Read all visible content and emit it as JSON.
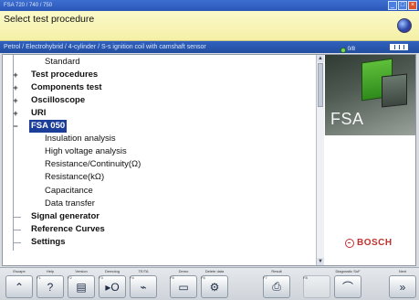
{
  "window": {
    "title": "FSA 720 / 740 / 750",
    "btn_min": "_",
    "btn_max": "□",
    "btn_close": "×"
  },
  "header": {
    "title": "Select test procedure",
    "globe_icon": "globe-icon"
  },
  "pathbar": {
    "text": "Petrol / Electrohybrid / 4-cylinder / S-s ignition coil with camshaft sensor",
    "indicator": "0/8"
  },
  "tree": {
    "items": [
      {
        "label": "Standard",
        "level": 1,
        "bold": false,
        "expander": ""
      },
      {
        "label": "Test procedures",
        "level": 0,
        "bold": true,
        "expander": "+"
      },
      {
        "label": "Components test",
        "level": 0,
        "bold": true,
        "expander": "+"
      },
      {
        "label": "Oscilloscope",
        "level": 0,
        "bold": true,
        "expander": "+"
      },
      {
        "label": "URI",
        "level": 0,
        "bold": true,
        "expander": "+"
      },
      {
        "label": "FSA 050",
        "level": 0,
        "bold": true,
        "expander": "−",
        "selected": true
      },
      {
        "label": "Insulation analysis",
        "level": 1,
        "bold": false,
        "expander": ""
      },
      {
        "label": "High voltage analysis",
        "level": 1,
        "bold": false,
        "expander": ""
      },
      {
        "label": "Resistance/Continuity(Ω)",
        "level": 1,
        "bold": false,
        "expander": ""
      },
      {
        "label": "Resistance(kΩ)",
        "level": 1,
        "bold": false,
        "expander": ""
      },
      {
        "label": "Capacitance",
        "level": 1,
        "bold": false,
        "expander": ""
      },
      {
        "label": "Data transfer",
        "level": 1,
        "bold": false,
        "expander": ""
      },
      {
        "label": "Signal generator",
        "level": 0,
        "bold": true,
        "expander": ""
      },
      {
        "label": "Reference Curves",
        "level": 0,
        "bold": true,
        "expander": ""
      },
      {
        "label": "Settings",
        "level": 0,
        "bold": true,
        "expander": ""
      }
    ]
  },
  "brand": {
    "product": "FSA",
    "company": "BOSCH"
  },
  "footer": {
    "buttons": [
      {
        "label": "Escape",
        "key": "",
        "glyph": "⌃",
        "icon": "double-chevron-up-icon"
      },
      {
        "label": "Help",
        "key": "F1",
        "glyph": "?",
        "icon": "help-icon"
      },
      {
        "label": "Version",
        "key": "F2",
        "glyph": "▤",
        "icon": "document-icon"
      },
      {
        "label": "Demolog",
        "key": "F3",
        "glyph": "▸O",
        "icon": "play-log-icon"
      },
      {
        "label": "TE/TA",
        "key": "F4",
        "glyph": "⌁",
        "icon": "probe-icon"
      },
      {
        "label": "Demo",
        "key": "F5",
        "glyph": "▭",
        "icon": "demo-icon"
      },
      {
        "label": "Delete data",
        "key": "F6",
        "glyph": "⚙",
        "icon": "delete-data-icon"
      },
      {
        "label": "Result",
        "key": "F7",
        "glyph": "⎙",
        "icon": "result-icon"
      },
      {
        "label": "",
        "key": "F8",
        "glyph": "",
        "icon": "empty-icon"
      },
      {
        "label": "Diagnostic SoF",
        "key": "",
        "glyph": "⌒",
        "icon": "diagnostic-icon"
      },
      {
        "label": "Next",
        "key": "",
        "glyph": "»",
        "icon": "double-chevron-right-icon"
      }
    ]
  }
}
